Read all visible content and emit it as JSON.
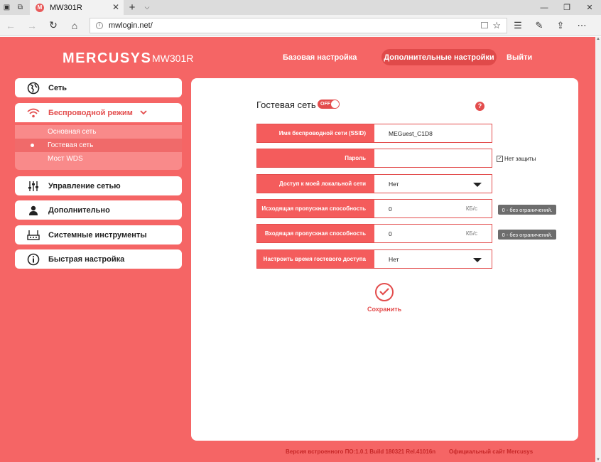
{
  "browser": {
    "tab_title": "MW301R",
    "favicon_letter": "M",
    "tab_close": "✕",
    "new_tab": "+",
    "tab_menu": "⌵",
    "url": "mwlogin.net/",
    "window_min": "—",
    "window_restore": "❐",
    "window_close": "✕"
  },
  "header": {
    "logo": "MERCUSYS",
    "model": "MW301R",
    "nav": {
      "basic": "Базовая настройка",
      "advanced": "Дополнительные настройки",
      "logout": "Выйти"
    }
  },
  "sidebar": {
    "items": [
      {
        "label": "Сеть",
        "icon": "globe-icon"
      },
      {
        "label": "Беспроводной режим",
        "icon": "wifi-icon"
      },
      {
        "label": "Управление сетью",
        "icon": "sliders-icon"
      },
      {
        "label": "Дополнительно",
        "icon": "user-icon"
      },
      {
        "label": "Системные инструменты",
        "icon": "router-icon"
      },
      {
        "label": "Быстрая настройка",
        "icon": "info-icon"
      }
    ],
    "submenu": [
      "Основная сеть",
      "Гостевая сеть",
      "Мост WDS"
    ]
  },
  "guest": {
    "title": "Гостевая сеть",
    "toggle": "OFF",
    "help": "?",
    "fields": {
      "ssid_label": "Имя беспроводной сети (SSID)",
      "ssid_value": "MEGuest_C1D8",
      "password_label": "Пароль",
      "password_value": "",
      "no_protection": "Нет защиты",
      "lan_access_label": "Доступ к моей локальной сети",
      "lan_access_value": "Нет",
      "upload_label": "Исходящая пропускная способность",
      "upload_value": "0",
      "upload_unit": "КБ/с",
      "upload_hint": "0 - без ограничений.",
      "download_label": "Входящая пропускная способность",
      "download_value": "0",
      "download_unit": "КБ/с",
      "download_hint": "0 - без ограничений.",
      "schedule_label": "Настроить время гостевого доступа",
      "schedule_value": "Нет"
    },
    "save": "Сохранить"
  },
  "footer": {
    "version": "Версия встроенного ПО:1.0.1 Build 180321 Rel.41016n",
    "site": "Официальный сайт Mercusys"
  },
  "colors": {
    "brand": "#f56565",
    "accent": "#e34d4d"
  }
}
